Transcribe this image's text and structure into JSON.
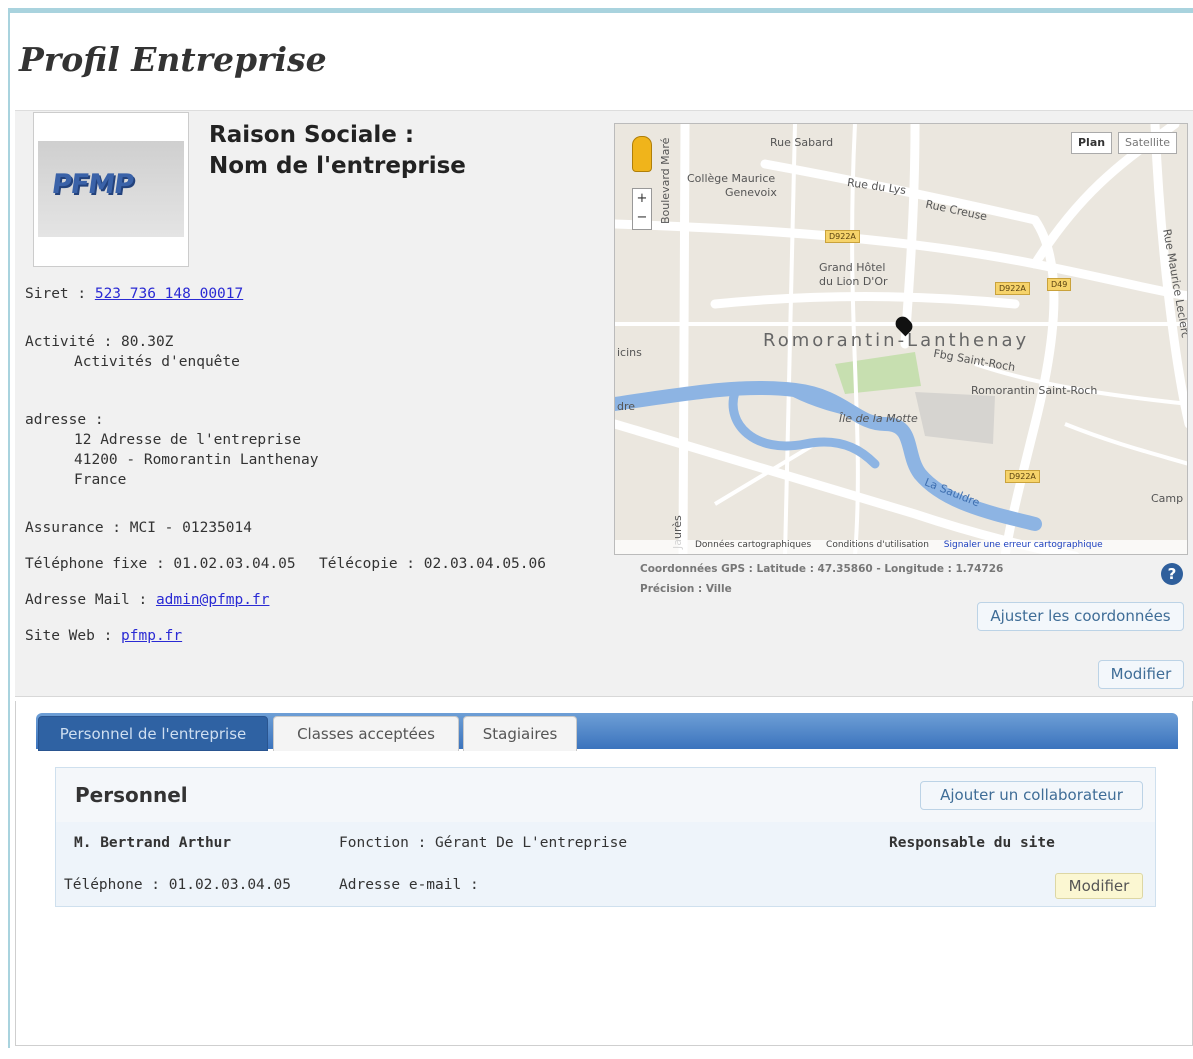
{
  "page": {
    "title": "Profil Entreprise"
  },
  "company": {
    "logo_text": "PFMP",
    "raison_line1": "Raison Sociale :",
    "raison_line2": "Nom de l'entreprise",
    "siret_label": "Siret : ",
    "siret_value": "523 736 148 00017",
    "activite_label": "Activité : 80.30Z",
    "activite_desc": "Activités d'enquête",
    "adresse_label": "adresse :",
    "adresse_line1": "12 Adresse de l'entreprise",
    "adresse_line2": "41200 - Romorantin Lanthenay",
    "adresse_line3": "France",
    "assurance": "Assurance : MCI - 01235014",
    "telephone": "Téléphone fixe : 01.02.03.04.05",
    "telecopie": "Télécopie : 02.03.04.05.06",
    "mail_label": "Adresse Mail : ",
    "mail_value": "admin@pfmp.fr",
    "web_label": "Site Web : ",
    "web_value": "pfmp.fr"
  },
  "map": {
    "type_plan": "Plan",
    "type_satellite": "Satellite",
    "city": "Romorantin-Lanthenay",
    "labels": {
      "rue_sabard": "Rue Sabard",
      "college": "Collège Maurice",
      "college2": "Genevoix",
      "rue_lys": "Rue du Lys",
      "rue_creuse": "Rue Creuse",
      "hotel": "Grand Hôtel",
      "hotel2": "du Lion D'Or",
      "boulevard": "Boulevard Maré",
      "faubourg": "Fbg Saint-Roch",
      "saint_roch": "Romorantin Saint-Roch",
      "ile": "Île de la Motte",
      "sauldre": "La Sauldre",
      "rue_leclerc": "Rue Maurice Leclerc",
      "camp": "Camp",
      "cins": "icins",
      "dre": "dre",
      "jaures": "Jaurès"
    },
    "badges": {
      "d922a": "D922A",
      "d49": "D49"
    },
    "footer_data": "Données cartographiques",
    "footer_terms": "Conditions d'utilisation",
    "footer_report": "Signaler une erreur cartographique",
    "gps_line": "Coordonnées GPS : Latitude : 47.35860 - Longitude : 1.74726",
    "precision_line": "Précision : Ville",
    "adjust_button": "Ajuster les coordonnées"
  },
  "profile_modify_button": "Modifier",
  "tabs": [
    {
      "label": "Personnel de l'entreprise",
      "active": true
    },
    {
      "label": "Classes acceptées",
      "active": false
    },
    {
      "label": "Stagiaires",
      "active": false
    }
  ],
  "personnel": {
    "title": "Personnel",
    "add_button": "Ajouter un collaborateur",
    "rows": [
      {
        "name": "M. Bertrand Arthur",
        "fonction": "Fonction : Gérant De L'entreprise",
        "role": "Responsable du site",
        "telephone": "Téléphone : 01.02.03.04.05",
        "email": "Adresse e-mail :",
        "modify": "Modifier"
      }
    ]
  },
  "colors": {
    "accent": "#3b73bd",
    "border": "#a9d3de",
    "link": "#2a2ad4"
  }
}
